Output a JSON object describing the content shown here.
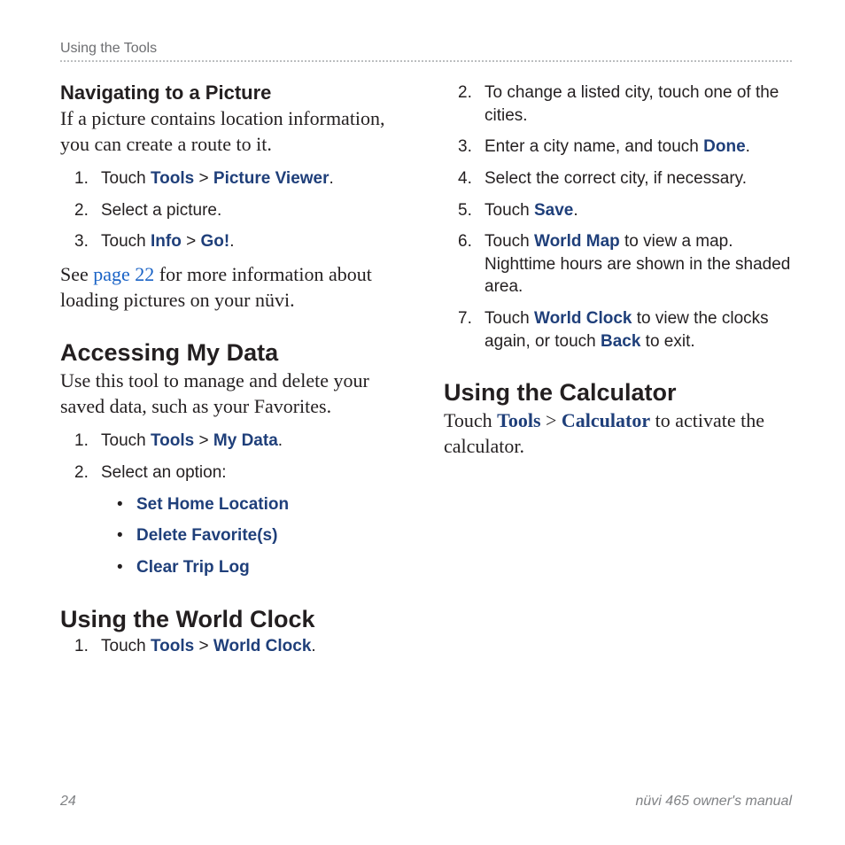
{
  "header": {
    "section": "Using the Tools"
  },
  "left": {
    "sub1_title": "Navigating to a Picture",
    "sub1_intro": "If a picture contains location information, you can create a route to it.",
    "sub1_steps": {
      "s1_a": "Touch ",
      "s1_b": "Tools",
      "s1_c": " > ",
      "s1_d": "Picture Viewer",
      "s1_e": ".",
      "s2": "Select a picture.",
      "s3_a": "Touch ",
      "s3_b": "Info",
      "s3_c": " > ",
      "s3_d": "Go!",
      "s3_e": "."
    },
    "sub1_after_a": "See ",
    "sub1_after_link": "page 22",
    "sub1_after_b": " for more information about loading pictures on your nüvi.",
    "sec2_title": "Accessing My Data",
    "sec2_intro": "Use this tool to manage and delete your saved data, such as your Favorites.",
    "sec2_steps": {
      "s1_a": "Touch ",
      "s1_b": "Tools",
      "s1_c": " > ",
      "s1_d": "My Data",
      "s1_e": ".",
      "s2": "Select an option:"
    },
    "sec2_bullets": {
      "b1": "Set Home Location",
      "b2": "Delete Favorite(s)",
      "b3": "Clear Trip Log"
    },
    "sec3_title": "Using the World Clock",
    "sec3_steps": {
      "s1_a": "Touch ",
      "s1_b": "Tools",
      "s1_c": " > ",
      "s1_d": "World Clock",
      "s1_e": "."
    }
  },
  "right": {
    "wc_steps": {
      "s2": "To change a listed city, touch one of the cities.",
      "s3_a": "Enter a city name, and touch ",
      "s3_b": "Done",
      "s3_c": ".",
      "s4": "Select the correct city, if necessary.",
      "s5_a": "Touch ",
      "s5_b": "Save",
      "s5_c": ".",
      "s6_a": "Touch ",
      "s6_b": "World Map",
      "s6_c": " to view a map. Nighttime hours are shown in the shaded area.",
      "s7_a": "Touch ",
      "s7_b": "World Clock",
      "s7_c": " to view the clocks again, or touch ",
      "s7_d": "Back",
      "s7_e": " to exit."
    },
    "calc_title": "Using the Calculator",
    "calc_a": "Touch ",
    "calc_b": "Tools",
    "calc_c": " > ",
    "calc_d": "Calculator",
    "calc_e": " to activate the calculator."
  },
  "footer": {
    "page": "24",
    "doc": "nüvi 465 owner's manual"
  }
}
